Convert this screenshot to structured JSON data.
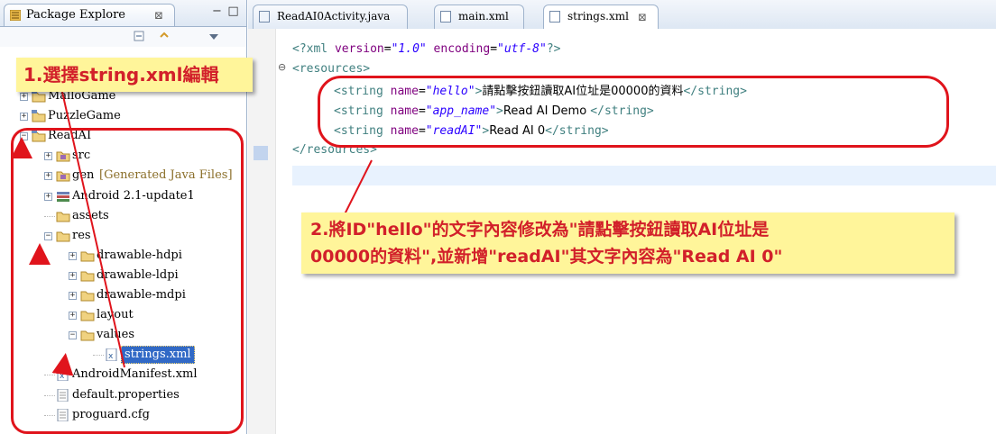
{
  "explorer": {
    "tab_label": "Package Explore",
    "tab_close": "⊠",
    "minimize": "−",
    "maximize": "□",
    "tree": [
      {
        "label": "MalloGame",
        "icon": "project-folder-icon",
        "expander": "+"
      },
      {
        "label": "PuzzleGame",
        "icon": "project-folder-icon",
        "expander": "+"
      },
      {
        "label": "ReadAI",
        "icon": "project-folder-icon",
        "expander": "−"
      },
      {
        "label": "src",
        "icon": "source-folder-icon",
        "expander": "+"
      },
      {
        "label": "gen",
        "note": "[Generated Java Files]",
        "icon": "source-folder-icon",
        "expander": "+"
      },
      {
        "label": "Android 2.1-update1",
        "icon": "library-icon",
        "expander": "+"
      },
      {
        "label": "assets",
        "icon": "folder-icon",
        "expander": ""
      },
      {
        "label": "res",
        "icon": "folder-icon",
        "expander": "−"
      },
      {
        "label": "drawable-hdpi",
        "icon": "folder-icon",
        "expander": "+"
      },
      {
        "label": "drawable-ldpi",
        "icon": "folder-icon",
        "expander": "+"
      },
      {
        "label": "drawable-mdpi",
        "icon": "folder-icon",
        "expander": "+"
      },
      {
        "label": "layout",
        "icon": "folder-icon",
        "expander": "+"
      },
      {
        "label": "values",
        "icon": "folder-icon",
        "expander": "−"
      },
      {
        "label": "strings.xml",
        "icon": "xml-file-icon",
        "expander": ""
      },
      {
        "label": "AndroidManifest.xml",
        "icon": "xml-file-icon",
        "expander": ""
      },
      {
        "label": "default.properties",
        "icon": "text-file-icon",
        "expander": ""
      },
      {
        "label": "proguard.cfg",
        "icon": "text-file-icon",
        "expander": ""
      }
    ]
  },
  "editor": {
    "tabs": [
      {
        "label": "ReadAI0Activity.java",
        "icon": "java-file-icon"
      },
      {
        "label": "main.xml",
        "icon": "xml-file-icon"
      },
      {
        "label": "strings.xml",
        "icon": "xml-file-icon",
        "close": "⊠"
      }
    ],
    "code": {
      "l1_open": "<?xml ",
      "l1_attr1": "version",
      "l1_eq1": "=",
      "l1_val1": "\"1.0\"",
      "l1_attr2": " encoding",
      "l1_eq2": "=",
      "l1_val2": "\"utf-8\"",
      "l1_close": "?>",
      "l2": "<resources>",
      "fold_marker": "⊖",
      "strings": [
        {
          "open": "<string ",
          "attr": "name",
          "eq": "=",
          "name": "\"hello\"",
          "gt": ">",
          "text": "請點擊按鈕讀取AI位址是00000的資料",
          "close": "</string>"
        },
        {
          "open": "<string ",
          "attr": "name",
          "eq": "=",
          "name": "\"app_name\"",
          "gt": ">",
          "text": "Read AI Demo ",
          "close": "</string>"
        },
        {
          "open": "<string ",
          "attr": "name",
          "eq": "=",
          "name": "\"readAI\"",
          "gt": ">",
          "text": "Read AI 0",
          "close": "</string>"
        }
      ],
      "l6": "</resources>"
    }
  },
  "annotations": {
    "step1": "1.選擇string.xml編輯",
    "step2_line1": "2.將ID\"hello\"的文字內容修改為\"請點擊按鈕讀取AI位址是",
    "step2_line2": "00000的資料\",並新增\"readAI\"其文字內容為\"Read AI 0\""
  },
  "colors": {
    "annotation_red": "#e0141c",
    "callout_yellow": "#fff59a",
    "selection_blue": "#3169c6",
    "xml_tag": "#3f7f7f",
    "xml_attr": "#7f007f",
    "xml_value": "#2a00ff"
  }
}
